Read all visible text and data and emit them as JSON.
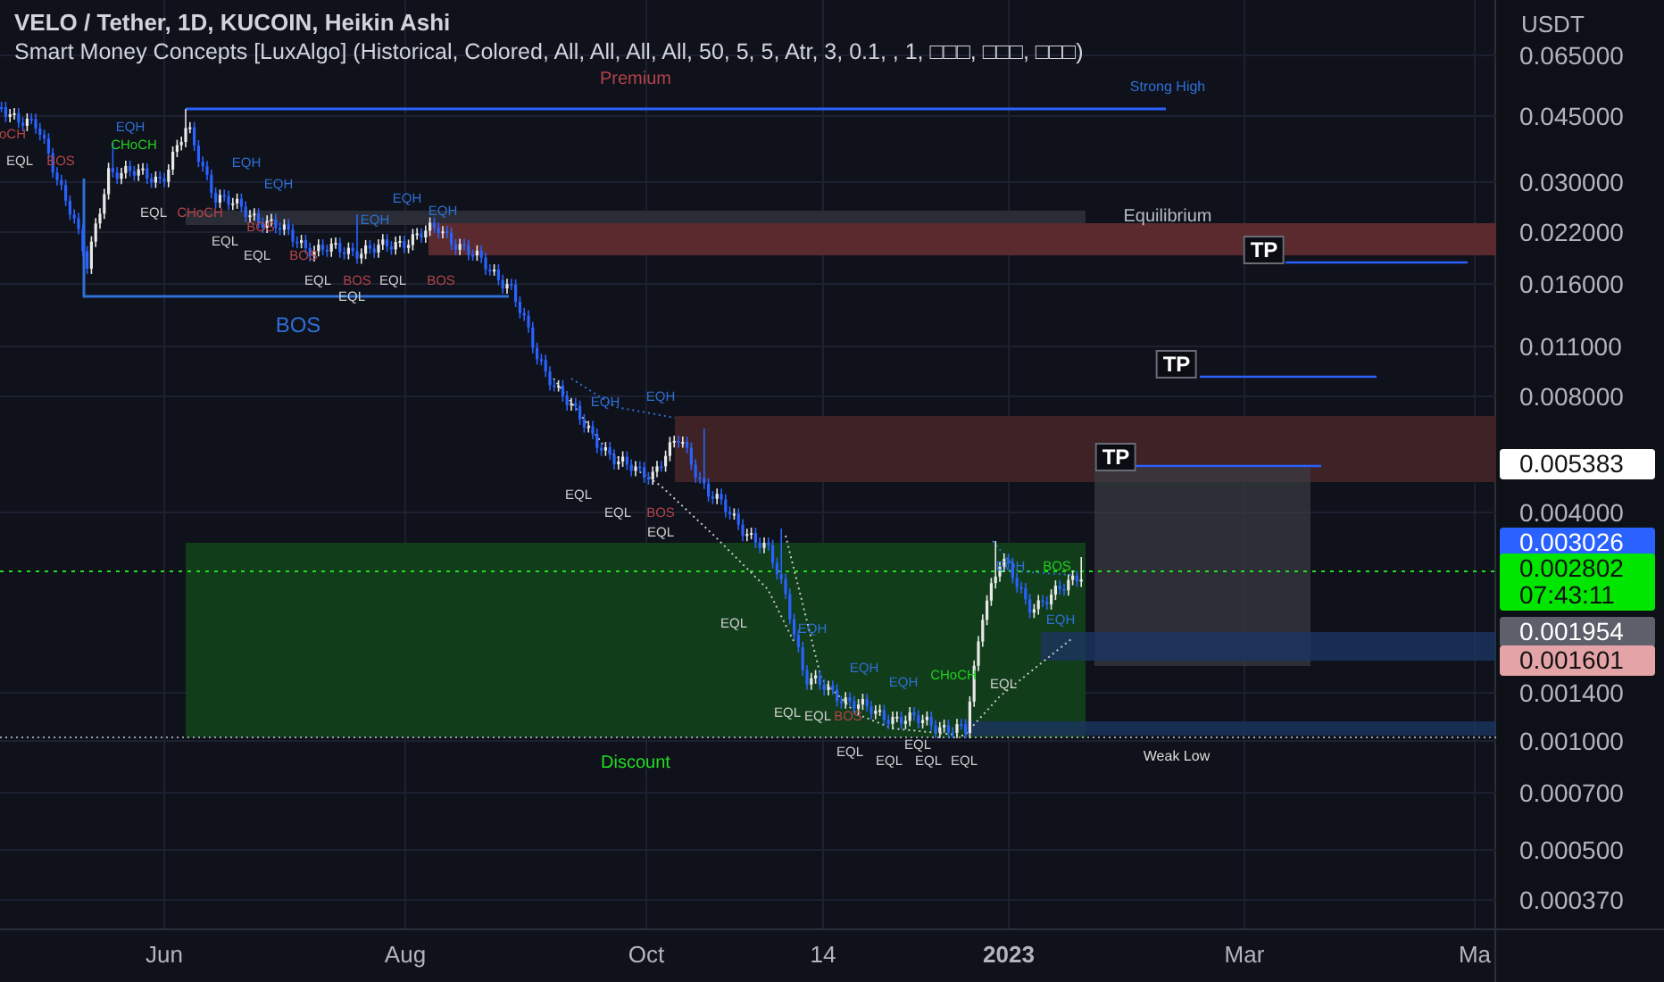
{
  "header": {
    "symbol": "VELO / Tether, 1D, KUCOIN, Heikin Ashi",
    "indicator": "Smart Money Concepts [LuxAlgo] (Historical, Colored, All, All, All, All, 50, 5, 5, Atr, 3, 0.1, , 1, □□□, □□□, □□□)"
  },
  "price_axis": {
    "unit": "USDT",
    "ticks": [
      "0.065000",
      "0.045000",
      "0.030000",
      "0.022000",
      "0.016000",
      "0.011000",
      "0.008000",
      "0.004000",
      "0.001400",
      "0.001000",
      "0.000700",
      "0.000500",
      "0.000370"
    ],
    "tags": [
      {
        "lines": [
          "0.005383"
        ],
        "color": "#ffffff"
      },
      {
        "lines": [
          "0.003026"
        ],
        "color": "#2962ff"
      },
      {
        "lines": [
          "0.002802",
          "07:43:11"
        ],
        "color": "#00e600"
      },
      {
        "lines": [
          "0.001954"
        ],
        "color": "#5d606b"
      },
      {
        "lines": [
          "0.001601"
        ],
        "color": "#e4a3a7"
      }
    ]
  },
  "time_axis": {
    "labels": [
      {
        "text": "Jun",
        "bold": false
      },
      {
        "text": "Aug",
        "bold": false
      },
      {
        "text": "Oct",
        "bold": false
      },
      {
        "text": "14",
        "bold": false
      },
      {
        "text": "2023",
        "bold": true
      },
      {
        "text": "Mar",
        "bold": false
      },
      {
        "text": "Ma",
        "bold": false
      }
    ]
  },
  "zone_labels": [
    {
      "text": "Premium",
      "color": "#b2444a"
    },
    {
      "text": "Strong High",
      "color": "#2f6fd6"
    },
    {
      "text": "Equilibrium",
      "color": "#b8bcc6"
    },
    {
      "text": "Discount",
      "color": "#22dd22"
    },
    {
      "text": "Weak Low",
      "color": "#dddddd"
    },
    {
      "text": "BOS",
      "color": "#2f6fd6"
    }
  ],
  "tp_tags": [
    "TP",
    "TP",
    "TP"
  ],
  "structure_labels": [
    {
      "text": "oCH",
      "color": "#b2444a"
    },
    {
      "text": "EQL",
      "color": "#d0d0d0"
    },
    {
      "text": "BOS",
      "color": "#b2444a"
    },
    {
      "text": "EQH",
      "color": "#2f6fd6"
    },
    {
      "text": "CHoCH",
      "color": "#22cc22"
    },
    {
      "text": "EQL",
      "color": "#d0d0d0"
    },
    {
      "text": "CHoCH",
      "color": "#b2444a"
    },
    {
      "text": "EQH",
      "color": "#2f6fd6"
    },
    {
      "text": "EQH",
      "color": "#2f6fd6"
    },
    {
      "text": "BOS",
      "color": "#b2444a"
    },
    {
      "text": "EQL",
      "color": "#d0d0d0"
    },
    {
      "text": "EQL",
      "color": "#d0d0d0"
    },
    {
      "text": "BOS",
      "color": "#b2444a"
    },
    {
      "text": "EQH",
      "color": "#2f6fd6"
    },
    {
      "text": "EQH",
      "color": "#2f6fd6"
    },
    {
      "text": "EQH",
      "color": "#2f6fd6"
    },
    {
      "text": "EQL",
      "color": "#d0d0d0"
    },
    {
      "text": "BOS",
      "color": "#b2444a"
    },
    {
      "text": "EQL",
      "color": "#d0d0d0"
    },
    {
      "text": "BOS",
      "color": "#b2444a"
    },
    {
      "text": "EQL",
      "color": "#d0d0d0"
    },
    {
      "text": "EQH",
      "color": "#2f6fd6"
    },
    {
      "text": "EQH",
      "color": "#2f6fd6"
    },
    {
      "text": "EQL",
      "color": "#d0d0d0"
    },
    {
      "text": "EQL",
      "color": "#d0d0d0"
    },
    {
      "text": "BOS",
      "color": "#b2444a"
    },
    {
      "text": "EQL",
      "color": "#d0d0d0"
    },
    {
      "text": "EQL",
      "color": "#d0d0d0"
    },
    {
      "text": "EQH",
      "color": "#2f6fd6"
    },
    {
      "text": "EQH",
      "color": "#2f6fd6"
    },
    {
      "text": "EQH",
      "color": "#2f6fd6"
    },
    {
      "text": "CHoCH",
      "color": "#22cc22"
    },
    {
      "text": "EQL",
      "color": "#d0d0d0"
    },
    {
      "text": "EQH",
      "color": "#2f6fd6"
    },
    {
      "text": "BOS",
      "color": "#22cc22"
    },
    {
      "text": "EQH",
      "color": "#2f6fd6"
    },
    {
      "text": "EQL",
      "color": "#d0d0d0"
    },
    {
      "text": "EQL",
      "color": "#d0d0d0"
    },
    {
      "text": "BOS",
      "color": "#b2444a"
    },
    {
      "text": "EQL",
      "color": "#d0d0d0"
    },
    {
      "text": "EQL",
      "color": "#d0d0d0"
    },
    {
      "text": "EQL",
      "color": "#d0d0d0"
    },
    {
      "text": "EQL",
      "color": "#d0d0d0"
    },
    {
      "text": "EQL",
      "color": "#d0d0d0"
    }
  ]
}
